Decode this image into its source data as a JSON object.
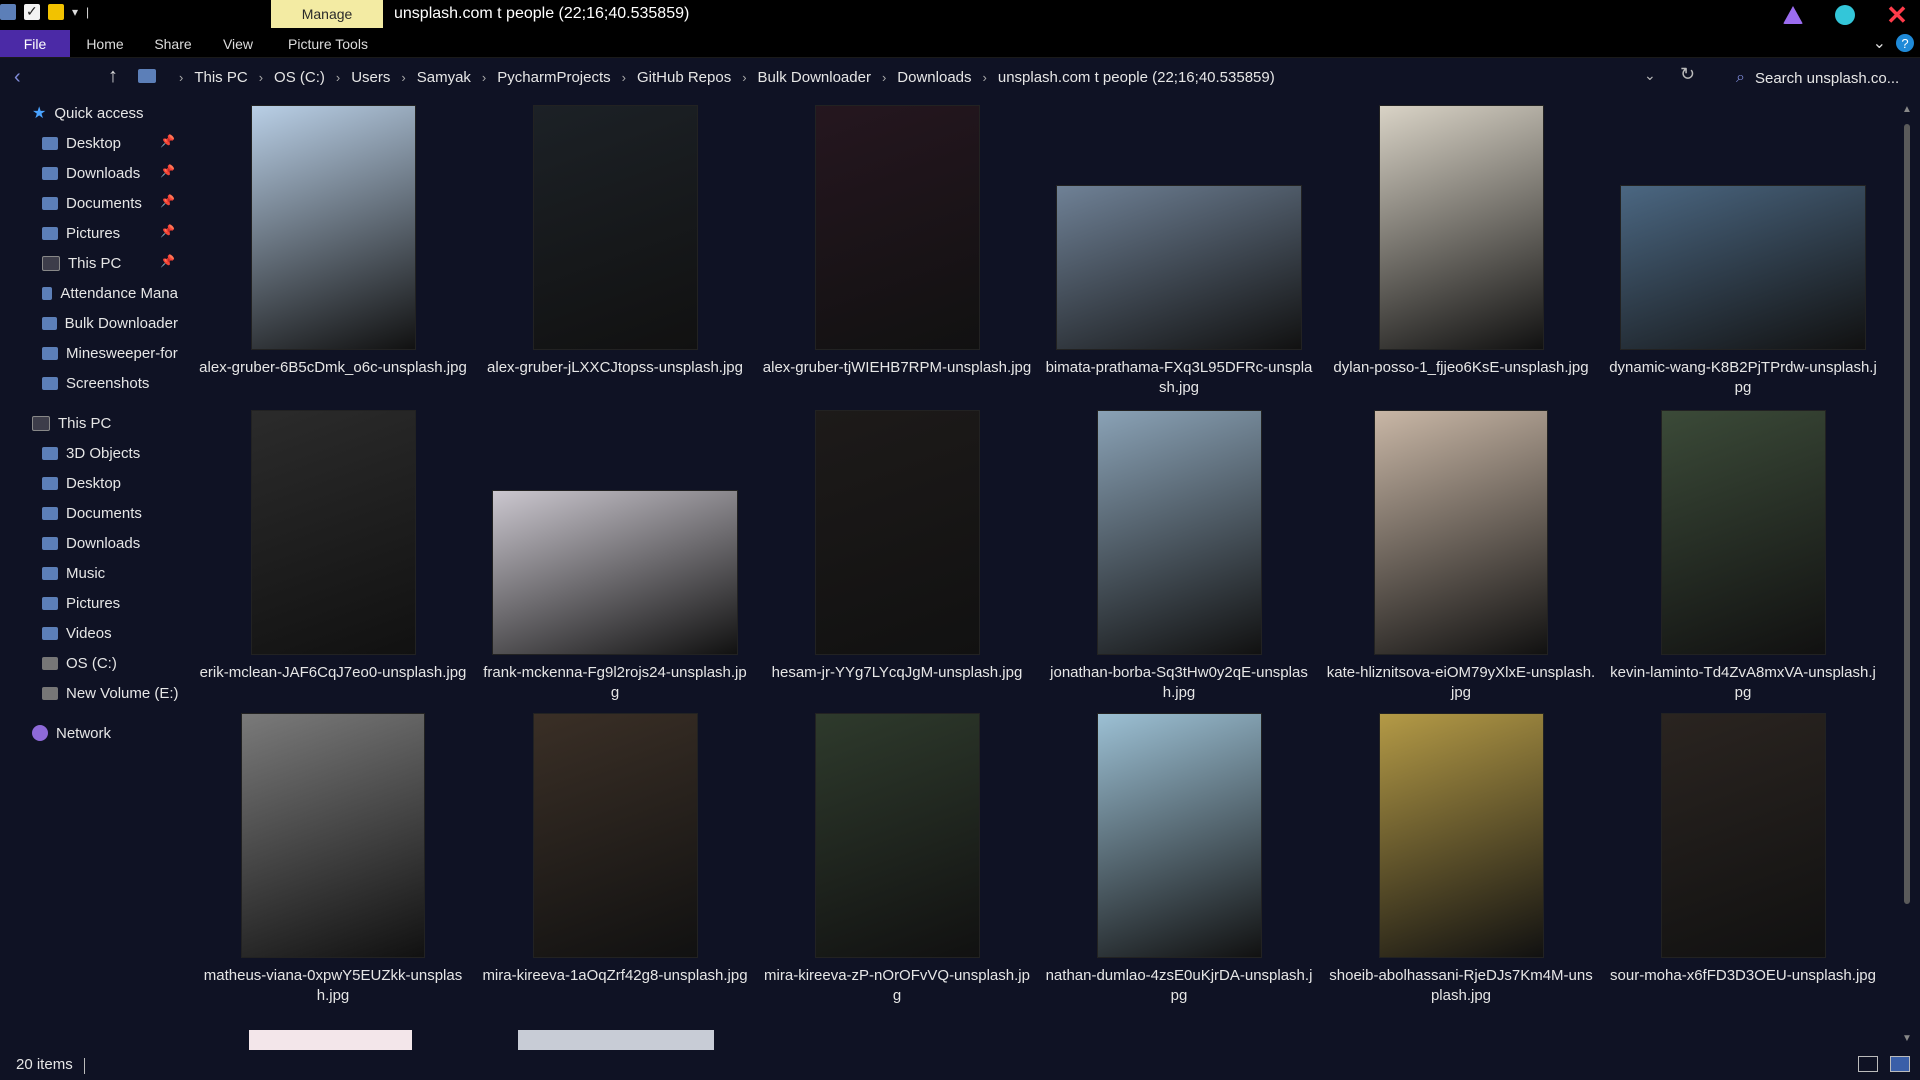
{
  "window": {
    "title": "unsplash.com t people (22;16;40.535859)",
    "manage_tab": "Manage"
  },
  "ribbon": {
    "tabs": [
      "File",
      "Home",
      "Share",
      "View",
      "Picture Tools"
    ]
  },
  "address": {
    "crumbs": [
      "This PC",
      "OS (C:)",
      "Users",
      "Samyak",
      "PycharmProjects",
      "GitHub Repos",
      "Bulk Downloader",
      "Downloads",
      "unsplash.com t people (22;16;40.535859)"
    ],
    "search_placeholder": "Search unsplash.co..."
  },
  "sidebar": {
    "quick_access": "Quick access",
    "quick_items": [
      "Desktop",
      "Downloads",
      "Documents",
      "Pictures",
      "This PC",
      "Attendance Mana",
      "Bulk Downloader",
      "Minesweeper-for",
      "Screenshots"
    ],
    "this_pc": "This PC",
    "pc_items": [
      "3D Objects",
      "Desktop",
      "Documents",
      "Downloads",
      "Music",
      "Pictures",
      "Videos",
      "OS (C:)",
      "New Volume (E:)"
    ],
    "network": "Network"
  },
  "files": [
    {
      "name": "alex-gruber-6B5cDmk_o6c-unsplash.jpg",
      "color": "#b9cfe6"
    },
    {
      "name": "alex-gruber-jLXXCJtopss-unsplash.jpg",
      "color": "#1c2126"
    },
    {
      "name": "alex-gruber-tjWIEHB7RPM-unsplash.jpg",
      "color": "#25161f"
    },
    {
      "name": "bimata-prathama-FXq3L95DFRc-unsplash.jpg",
      "color": "#6f8196"
    },
    {
      "name": "dylan-posso-1_fjjeo6KsE-unsplash.jpg",
      "color": "#d9d3c6"
    },
    {
      "name": "dynamic-wang-K8B2PjTPrdw-unsplash.jpg",
      "color": "#4b6782"
    },
    {
      "name": "erik-mclean-JAF6CqJ7eo0-unsplash.jpg",
      "color": "#2b2b2b"
    },
    {
      "name": "frank-mckenna-Fg9l2rojs24-unsplash.jpg",
      "color": "#cbc7cf"
    },
    {
      "name": "hesam-jr-YYg7LYcqJgM-unsplash.jpg",
      "color": "#1d1a19"
    },
    {
      "name": "jonathan-borba-Sq3tHw0y2qE-unsplash.jpg",
      "color": "#8aa2b6"
    },
    {
      "name": "kate-hliznitsova-eiOM79yXlxE-unsplash.jpg",
      "color": "#c9b7a6"
    },
    {
      "name": "kevin-laminto-Td4ZvA8mxVA-unsplash.jpg",
      "color": "#3b4a38"
    },
    {
      "name": "matheus-viana-0xpwY5EUZkk-unsplash.jpg",
      "color": "#7a7a7a"
    },
    {
      "name": "mira-kireeva-1aOqZrf42g8-unsplash.jpg",
      "color": "#3a2f26"
    },
    {
      "name": "mira-kireeva-zP-nOrOFvVQ-unsplash.jpg",
      "color": "#2e3a2c"
    },
    {
      "name": "nathan-dumlao-4zsE0uKjrDA-unsplash.jpg",
      "color": "#9cc0d4"
    },
    {
      "name": "shoeib-abolhassani-RjeDJs7Km4M-unsplash.jpg",
      "color": "#b49a46"
    },
    {
      "name": "sour-moha-x6fFD3D3OEU-unsplash.jpg",
      "color": "#2a2420"
    }
  ],
  "partial_row_colors": [
    "#f3e6ea",
    "#c8ccd6"
  ],
  "status": {
    "count": "20 items"
  }
}
